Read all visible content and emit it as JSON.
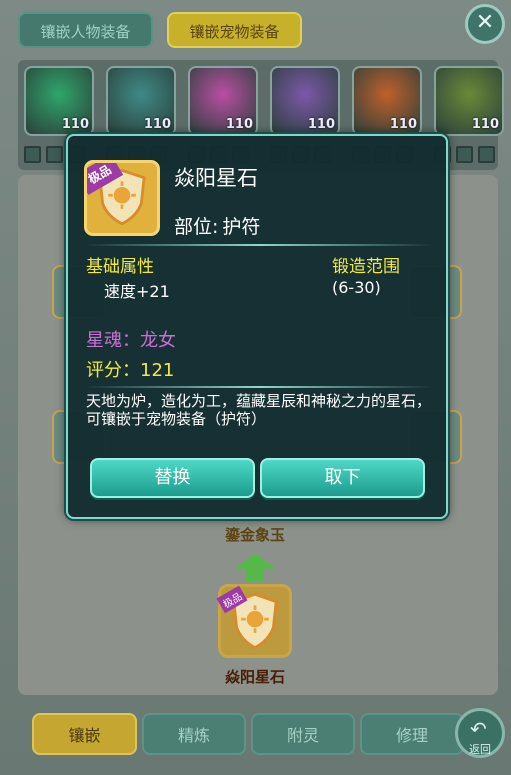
{
  "top_tabs": {
    "tab1": "镶嵌人物装备",
    "tab2": "镶嵌宠物装备"
  },
  "close_label": "✕",
  "pets": [
    {
      "level": "110",
      "color": "#2fa66a"
    },
    {
      "level": "110",
      "color": "#3f8a86"
    },
    {
      "level": "110",
      "color": "#b94fa3"
    },
    {
      "level": "110",
      "color": "#7c58a8"
    },
    {
      "level": "110",
      "color": "#c0602b"
    },
    {
      "level": "110",
      "color": "#6a8a38"
    }
  ],
  "scene": {
    "target_name": "鎏金象玉",
    "bottom_gem_name": "焱阳星石",
    "bottom_gem_badge": "极品"
  },
  "bottom_tabs": [
    "镶嵌",
    "精炼",
    "附灵",
    "修理"
  ],
  "back_label": "返回",
  "popup": {
    "badge": "极品",
    "name": "焱阳星石",
    "slot_label": "部位:",
    "slot_value": "护符",
    "base_title": "基础属性",
    "speed": "速度+21",
    "forge_title": "锻造范围",
    "forge_range": "(6-30)",
    "soul": "星魂：龙女",
    "score": "评分：121",
    "desc": "天地为炉，造化为工，蕴藏星辰和神秘之力的星石，可镶嵌于宠物装备（护符）",
    "btn_replace": "替换",
    "btn_remove": "取下"
  }
}
